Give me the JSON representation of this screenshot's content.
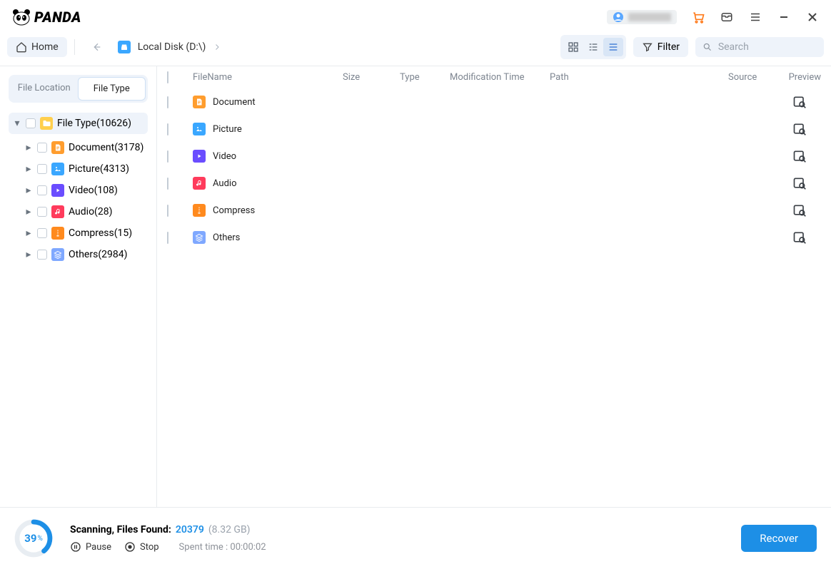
{
  "titlebar": {
    "brand": "PANDA"
  },
  "toolbar": {
    "home_label": "Home",
    "location_label": "Local Disk (D:\\)",
    "filter_label": "Filter",
    "search_placeholder": "Search"
  },
  "sidebar": {
    "tab_location": "File Location",
    "tab_type": "File Type",
    "root_label": "File Type(10626)",
    "items": [
      {
        "label": "Document(3178)",
        "icon": "doc"
      },
      {
        "label": "Picture(4313)",
        "icon": "pic"
      },
      {
        "label": "Video(108)",
        "icon": "vid"
      },
      {
        "label": "Audio(28)",
        "icon": "aud"
      },
      {
        "label": "Compress(15)",
        "icon": "cmp"
      },
      {
        "label": "Others(2984)",
        "icon": "oth"
      }
    ]
  },
  "list": {
    "cols": {
      "name": "FileName",
      "size": "Size",
      "type": "Type",
      "mtime": "Modification Time",
      "path": "Path",
      "source": "Source",
      "preview": "Preview"
    },
    "rows": [
      {
        "label": "Document",
        "icon": "doc"
      },
      {
        "label": "Picture",
        "icon": "pic"
      },
      {
        "label": "Video",
        "icon": "vid"
      },
      {
        "label": "Audio",
        "icon": "aud"
      },
      {
        "label": "Compress",
        "icon": "cmp"
      },
      {
        "label": "Others",
        "icon": "oth"
      }
    ]
  },
  "footer": {
    "progress_number": "39",
    "progress_unit": "%",
    "status_label": "Scanning, Files Found:",
    "found_count": "20379",
    "found_size": "(8.32 GB)",
    "pause_label": "Pause",
    "stop_label": "Stop",
    "time_label": "Spent time : 00:00:02",
    "recover_label": "Recover"
  }
}
